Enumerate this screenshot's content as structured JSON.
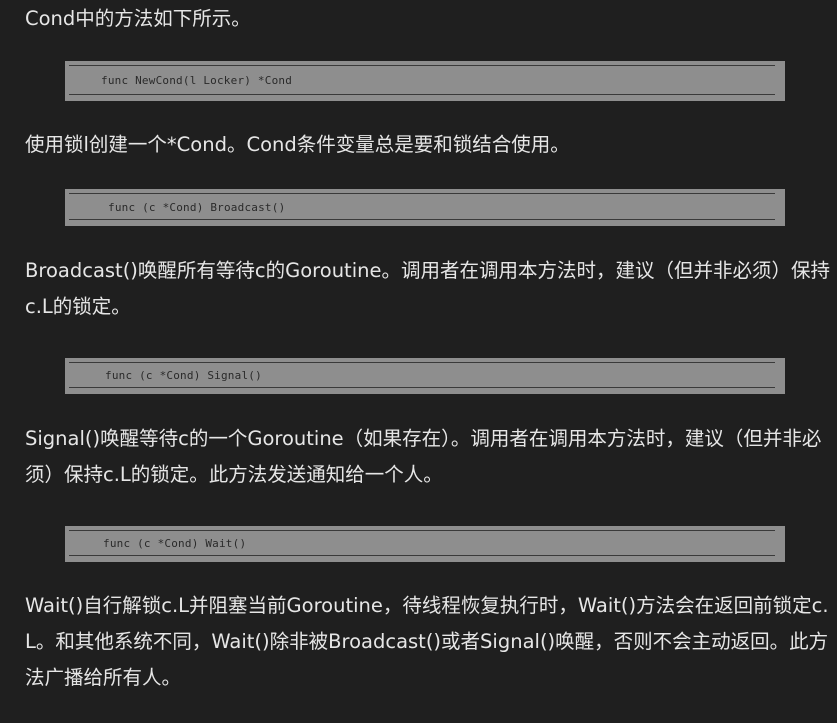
{
  "intro": "Cond中的方法如下所示。",
  "methods": [
    {
      "signature": "func NewCond(l Locker) *Cond",
      "description": "使用锁l创建一个*Cond。Cond条件变量总是要和锁结合使用。"
    },
    {
      "signature": "func (c *Cond) Broadcast()",
      "description": "Broadcast()唤醒所有等待c的Goroutine。调用者在调用本方法时，建议（但并非必须）保持c.L的锁定。"
    },
    {
      "signature": "func (c *Cond) Signal()",
      "description": "Signal()唤醒等待c的一个Goroutine（如果存在）。调用者在调用本方法时，建议（但并非必须）保持c.L的锁定。此方法发送通知给一个人。"
    },
    {
      "signature": "func (c *Cond) Wait()",
      "description": "Wait()自行解锁c.L并阻塞当前Goroutine，待线程恢复执行时，Wait()方法会在返回前锁定c.L。和其他系统不同，Wait()除非被Broadcast()或者Signal()唤醒，否则不会主动返回。此方法广播给所有人。"
    }
  ]
}
